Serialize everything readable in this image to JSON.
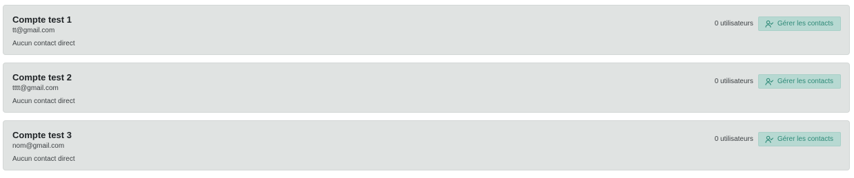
{
  "accounts": [
    {
      "name": "Compte test 1",
      "email": "tt@gmail.com",
      "contact": "Aucun contact direct",
      "users": "0 utilisateurs",
      "manage_label": "Gérer les contacts"
    },
    {
      "name": "Compte test 2",
      "email": "tttt@gmail.com",
      "contact": "Aucun contact direct",
      "users": "0 utilisateurs",
      "manage_label": "Gérer les contacts"
    },
    {
      "name": "Compte test 3",
      "email": "nom@gmail.com",
      "contact": "Aucun contact direct",
      "users": "0 utilisateurs",
      "manage_label": "Gérer les contacts"
    }
  ],
  "icons": {
    "manage": "user-check-icon"
  },
  "colors": {
    "card_background": "#e0e3e2",
    "button_background": "#b7d9d2",
    "button_text": "#2f8a78"
  }
}
